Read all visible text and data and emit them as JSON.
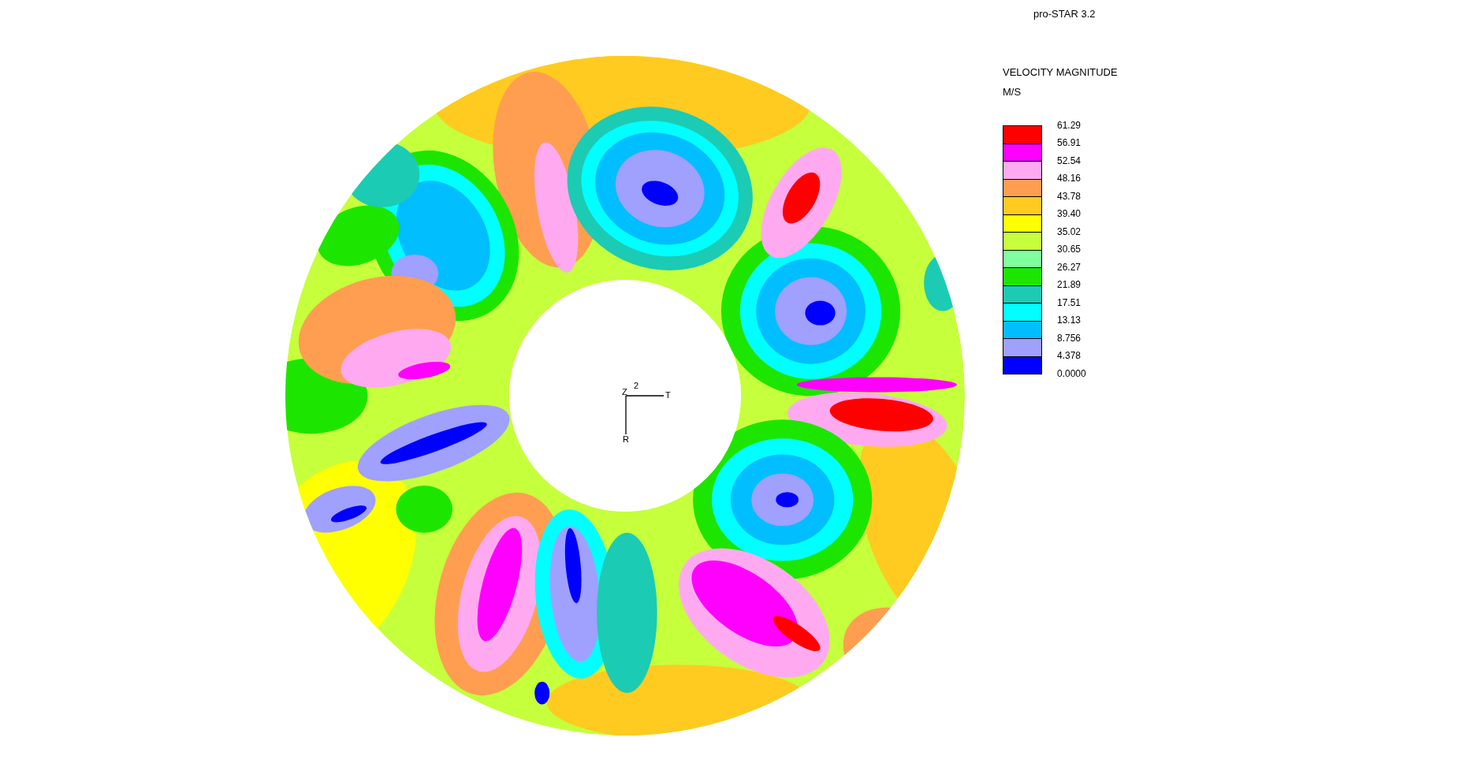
{
  "header": {
    "title": "pro-STAR 3.2"
  },
  "legend": {
    "title": "VELOCITY MAGNITUDE",
    "unit": "M/S",
    "bands": [
      {
        "color": "#ff0000"
      },
      {
        "color": "#ff00ff"
      },
      {
        "color": "#ffaaf0"
      },
      {
        "color": "#ff9e50"
      },
      {
        "color": "#ffcb20"
      },
      {
        "color": "#ffff00"
      },
      {
        "color": "#c6ff3c"
      },
      {
        "color": "#80ff9e"
      },
      {
        "color": "#1ce600"
      },
      {
        "color": "#1ccbb4"
      },
      {
        "color": "#00ffff"
      },
      {
        "color": "#00beff"
      },
      {
        "color": "#a0a0ff"
      },
      {
        "color": "#0000ff"
      }
    ],
    "labels": [
      "61.29",
      "56.91",
      "52.54",
      "48.16",
      "43.78",
      "39.40",
      "35.02",
      "30.65",
      "26.27",
      "21.89",
      "17.51",
      "13.13",
      "8.756",
      "4.378",
      "0.0000"
    ]
  },
  "axes": {
    "vertical_label": "Z",
    "index": "2",
    "horizontal_label": "T",
    "down_label": "R"
  }
}
